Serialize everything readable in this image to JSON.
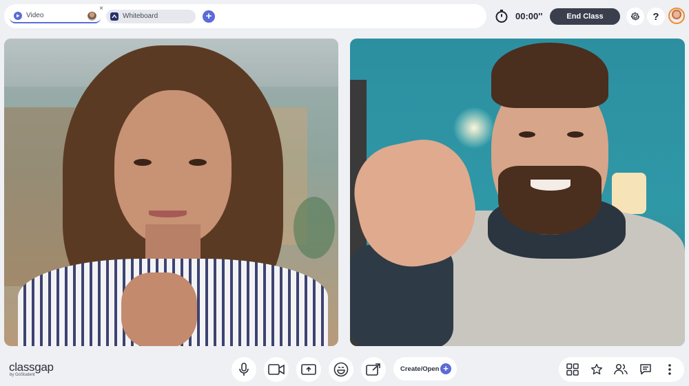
{
  "tabs": [
    {
      "label": "Video",
      "icon": "video-tab-icon",
      "active": true
    },
    {
      "label": "Whiteboard",
      "icon": "whiteboard-tab-icon",
      "active": false
    }
  ],
  "header": {
    "timer": "00:00''",
    "end_class_label": "End Class",
    "help_label": "?"
  },
  "brand": {
    "name": "classgap",
    "tagline": "by GoStudent"
  },
  "toolbar": {
    "create_open_label": "Create/Open"
  },
  "colors": {
    "accent": "#5b6bd8",
    "end_button": "#3b3f4d",
    "avatar_ring": "#f08a2c"
  }
}
